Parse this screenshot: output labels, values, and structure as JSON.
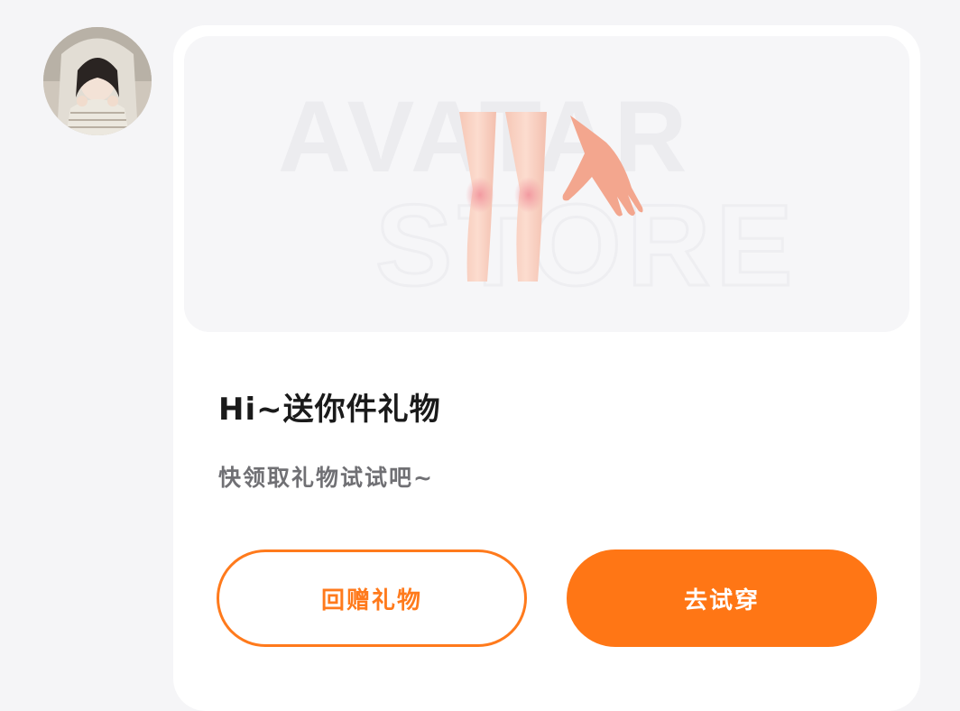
{
  "message": {
    "avatar_icon": "user-avatar-photo",
    "banner": {
      "watermark_line1": "AVATAR",
      "watermark_line2": "STORE",
      "icon": "legs-and-hand-avatar-item"
    },
    "title": "Hi~送你件礼物",
    "subtitle": "快领取礼物试试吧~",
    "buttons": {
      "return_gift": "回赠礼物",
      "try_on": "去试穿"
    },
    "colors": {
      "accent": "#ff7615",
      "title": "#1a1a1a",
      "subtitle": "#707074",
      "page_background": "#f5f5f7"
    }
  }
}
